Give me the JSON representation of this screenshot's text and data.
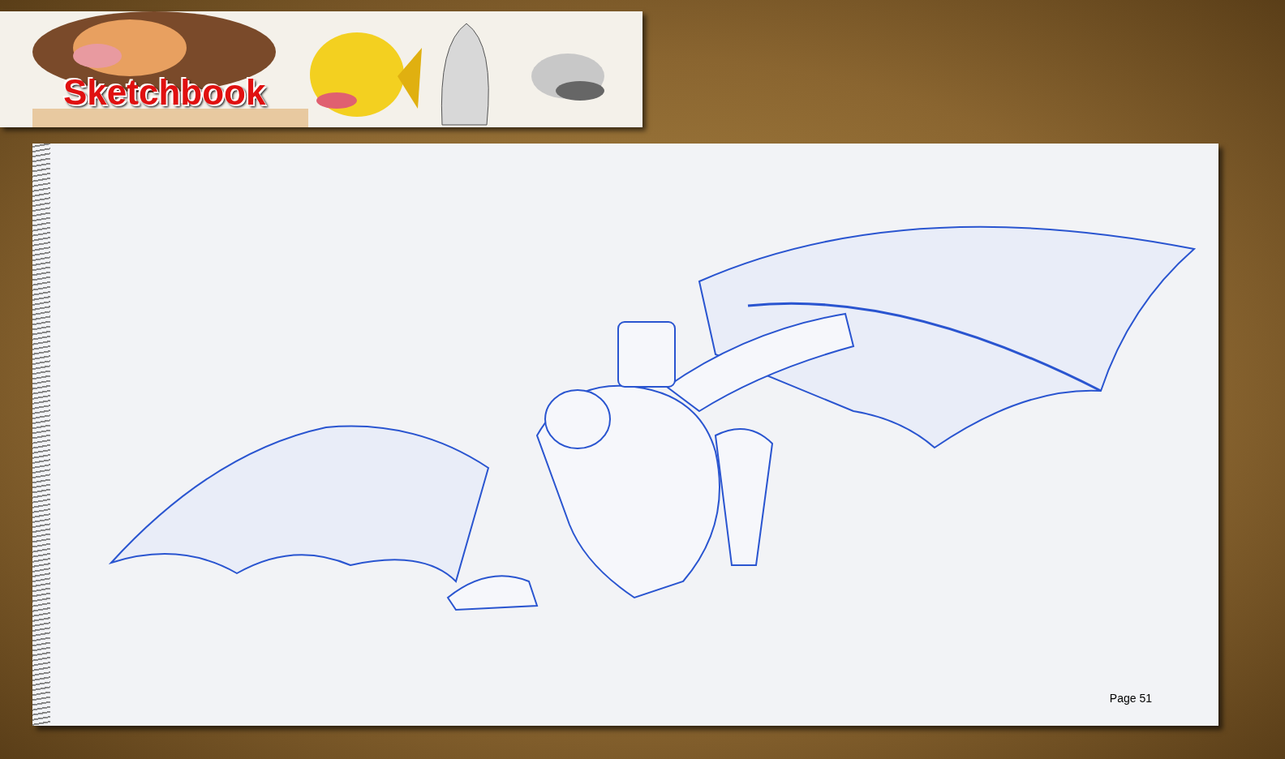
{
  "header": {
    "title": "Sketchbook"
  },
  "sketchbook_page": {
    "page_label": "Page 51"
  }
}
